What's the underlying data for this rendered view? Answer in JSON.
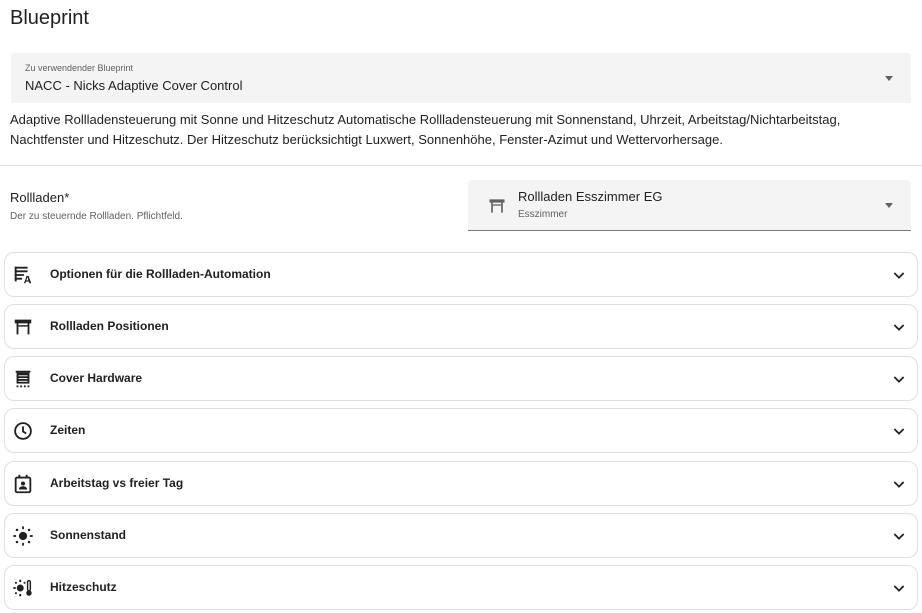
{
  "page_title": "Blueprint",
  "blueprint_select": {
    "label": "Zu verwendender Blueprint",
    "value": "NACC - Nicks Adaptive Cover Control"
  },
  "description": "Adaptive Rollladensteuerung mit Sonne und Hitzeschutz Automatische Rollladensteuerung mit Sonnenstand, Uhrzeit, Arbeitstag/Nichtarbeitstag, Nachtfenster und Hitzeschutz. Der Hitzeschutz berücksichtigt Luxwert, Sonnenhöhe, Fenster-Azimut und Wettervorhersage.",
  "cover_field": {
    "label": "Rollladen*",
    "helper": "Der zu steuernde Rollladen. Pflichtfeld.",
    "selected_name": "Rollladen Esszimmer EG",
    "selected_area": "Esszimmer",
    "icon": "window-shutter-icon"
  },
  "sections": [
    {
      "label": "Optionen für die Rollladen-Automation",
      "icon": "text-box-options-icon"
    },
    {
      "label": "Rollladen Positionen",
      "icon": "window-shutter-icon"
    },
    {
      "label": "Cover Hardware",
      "icon": "roller-shade-icon"
    },
    {
      "label": "Zeiten",
      "icon": "clock-icon"
    },
    {
      "label": "Arbeitstag vs freier Tag",
      "icon": "calendar-account-icon"
    },
    {
      "label": "Sonnenstand",
      "icon": "sun-icon"
    },
    {
      "label": "Hitzeschutz",
      "icon": "sun-thermometer-icon"
    }
  ],
  "colors": {
    "field_bg": "#f4f4f4",
    "text": "#212121",
    "secondary_text": "#616161",
    "border": "#e0e0e0"
  }
}
